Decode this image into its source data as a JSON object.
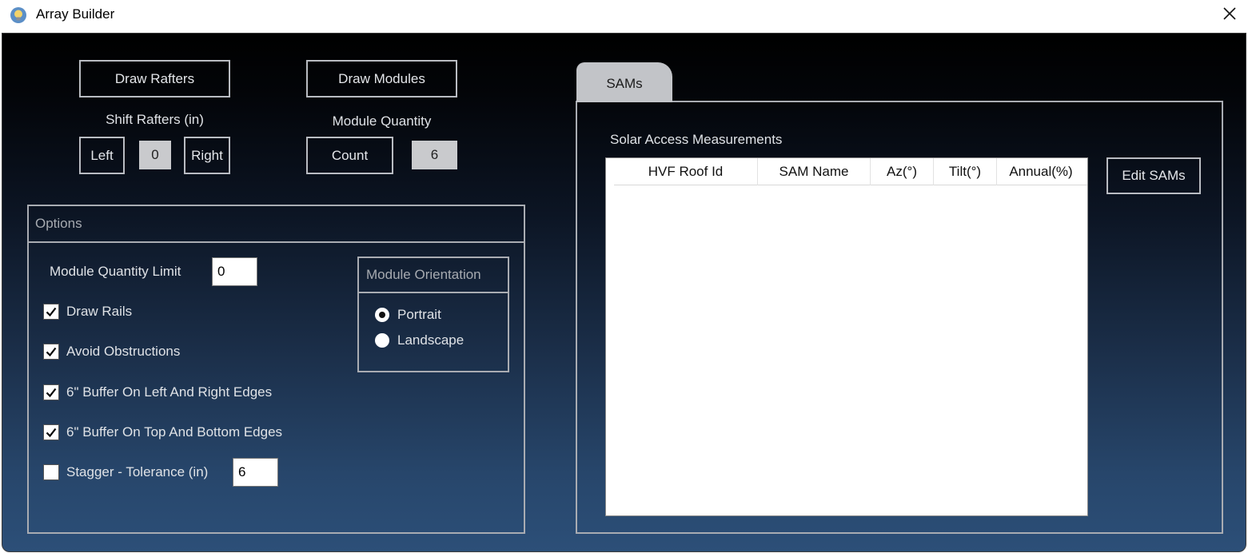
{
  "window": {
    "title": "Array Builder",
    "app_icon": "lightbulb-icon",
    "close_icon": "close-icon"
  },
  "rafters": {
    "draw_label": "Draw Rafters",
    "shift_label": "Shift Rafters (in)",
    "left_label": "Left",
    "shift_value": "0",
    "right_label": "Right"
  },
  "modules": {
    "draw_label": "Draw Modules",
    "quantity_label": "Module Quantity",
    "count_label": "Count",
    "count_value": "6"
  },
  "options": {
    "header": "Options",
    "quantity_limit_label": "Module Quantity Limit",
    "quantity_limit_value": "0",
    "checkboxes": [
      {
        "label": "Draw Rails",
        "checked": true
      },
      {
        "label": "Avoid Obstructions",
        "checked": true
      },
      {
        "label": "6\" Buffer On Left And Right Edges",
        "checked": true
      },
      {
        "label": "6\" Buffer On Top And Bottom Edges",
        "checked": true
      },
      {
        "label": "Stagger - Tolerance (in)",
        "checked": false
      }
    ],
    "stagger_value": "6",
    "orientation": {
      "header": "Module Orientation",
      "options": [
        {
          "label": "Portrait",
          "selected": true
        },
        {
          "label": "Landscape",
          "selected": false
        }
      ]
    }
  },
  "sams": {
    "tab_label": "SAMs",
    "section_label": "Solar Access Measurements",
    "columns": [
      "HVF Roof Id",
      "SAM Name",
      "Az(°)",
      "Tilt(°)",
      "Annual(%)"
    ],
    "rows": [],
    "edit_label": "Edit SAMs"
  }
}
